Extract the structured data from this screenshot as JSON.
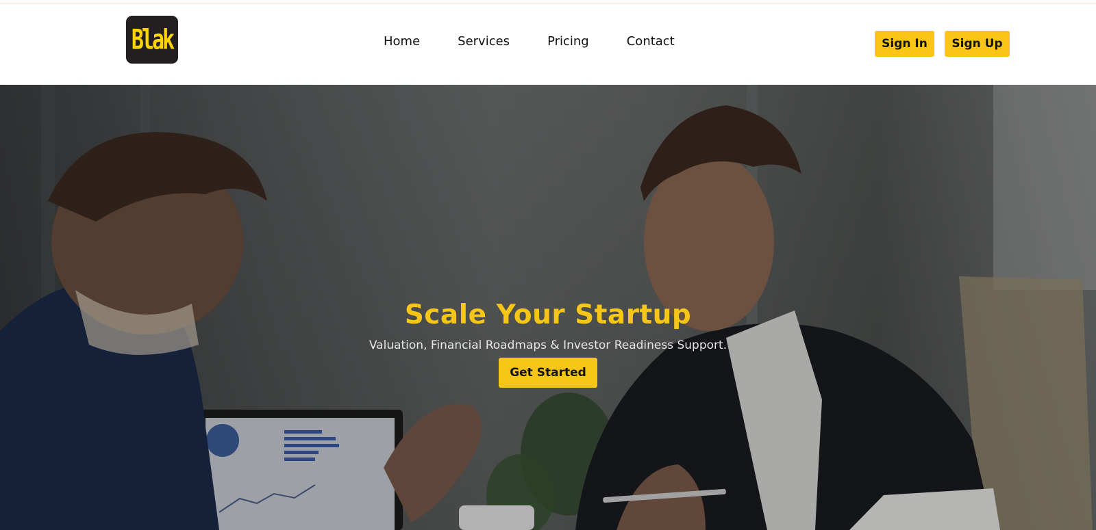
{
  "brand": {
    "logo_text": "Blak",
    "accent": "#fcc417",
    "dark": "#231f20"
  },
  "nav": {
    "items": [
      "Home",
      "Services",
      "Pricing",
      "Contact"
    ]
  },
  "auth": {
    "sign_in": "Sign In",
    "sign_up": "Sign Up"
  },
  "hero": {
    "title": "Scale Your Startup",
    "subtitle": "Valuation, Financial Roadmaps & Investor Readiness Support.",
    "cta": "Get Started",
    "image": "two-businessmen-meeting-photo"
  }
}
